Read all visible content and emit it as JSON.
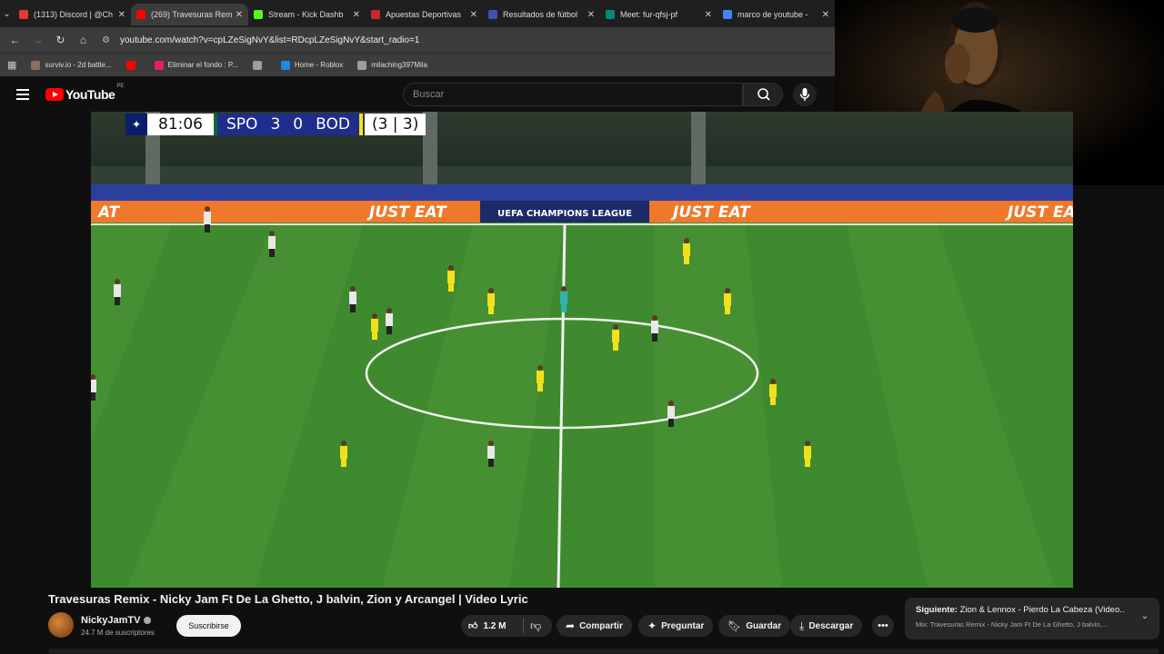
{
  "tabs": [
    {
      "title": "(1313) Discord | @Ch",
      "color": "#e53935",
      "active": false
    },
    {
      "title": "(269) Travesuras Rem",
      "color": "#ff0000",
      "active": true
    },
    {
      "title": "Stream - Kick Dashb",
      "color": "#53fc18",
      "active": false
    },
    {
      "title": "Apuestas Deportivas",
      "color": "#c62828",
      "active": false
    },
    {
      "title": "Resultados de fútbol",
      "color": "#3f51b5",
      "active": false
    },
    {
      "title": "Meet: fur-qfsj-pf",
      "color": "#00897b",
      "active": false
    },
    {
      "title": "marco de youtube -",
      "color": "#4285f4",
      "active": false
    }
  ],
  "address": {
    "url": "youtube.com/watch?v=cpLZeSigNvY&list=RDcpLZeSigNvY&start_radio=1"
  },
  "bookmarks": [
    {
      "label": "surviv.io - 2d battle...",
      "color": "#8d6e63"
    },
    {
      "label": "",
      "color": "#ff0000"
    },
    {
      "label": "Eliminar el fondo : P...",
      "color": "#e91e63"
    },
    {
      "label": "",
      "color": "#9e9e9e"
    },
    {
      "label": "Home - Roblox",
      "color": "#1e88e5"
    },
    {
      "label": "milaching397Mila",
      "color": "#9e9e9e"
    }
  ],
  "youtube": {
    "logo_text": "YouTube",
    "country_code": "PE",
    "search_placeholder": "Buscar"
  },
  "scoreboard": {
    "time": "81:06",
    "home": "SPO",
    "home_score": "3",
    "away_score": "0",
    "away": "BOD",
    "aggregate": "(3 | 3)"
  },
  "ad_boards": {
    "sponsor": "JUST EAT",
    "competition": "UEFA CHAMPIONS LEAGUE"
  },
  "video": {
    "title": "Travesuras Remix - Nicky Jam Ft De La Ghetto, J balvin, Zion y Arcangel | Video Lyric",
    "channel": "NickyJamTV",
    "subscribers": "24.7 M de suscriptores",
    "subscribe_label": "Suscribirse",
    "likes": "1.2 M",
    "share_label": "Compartir",
    "ask_label": "Preguntar",
    "save_label": "Guardar",
    "download_label": "Descargar"
  },
  "next": {
    "prefix": "Siguiente:",
    "title": "Zion & Lennox - Pierdo La Cabeza (Video...",
    "mix": "Mix: Travesuras Remix - Nicky Jam Ft De La Ghetto, J balvin,..."
  }
}
